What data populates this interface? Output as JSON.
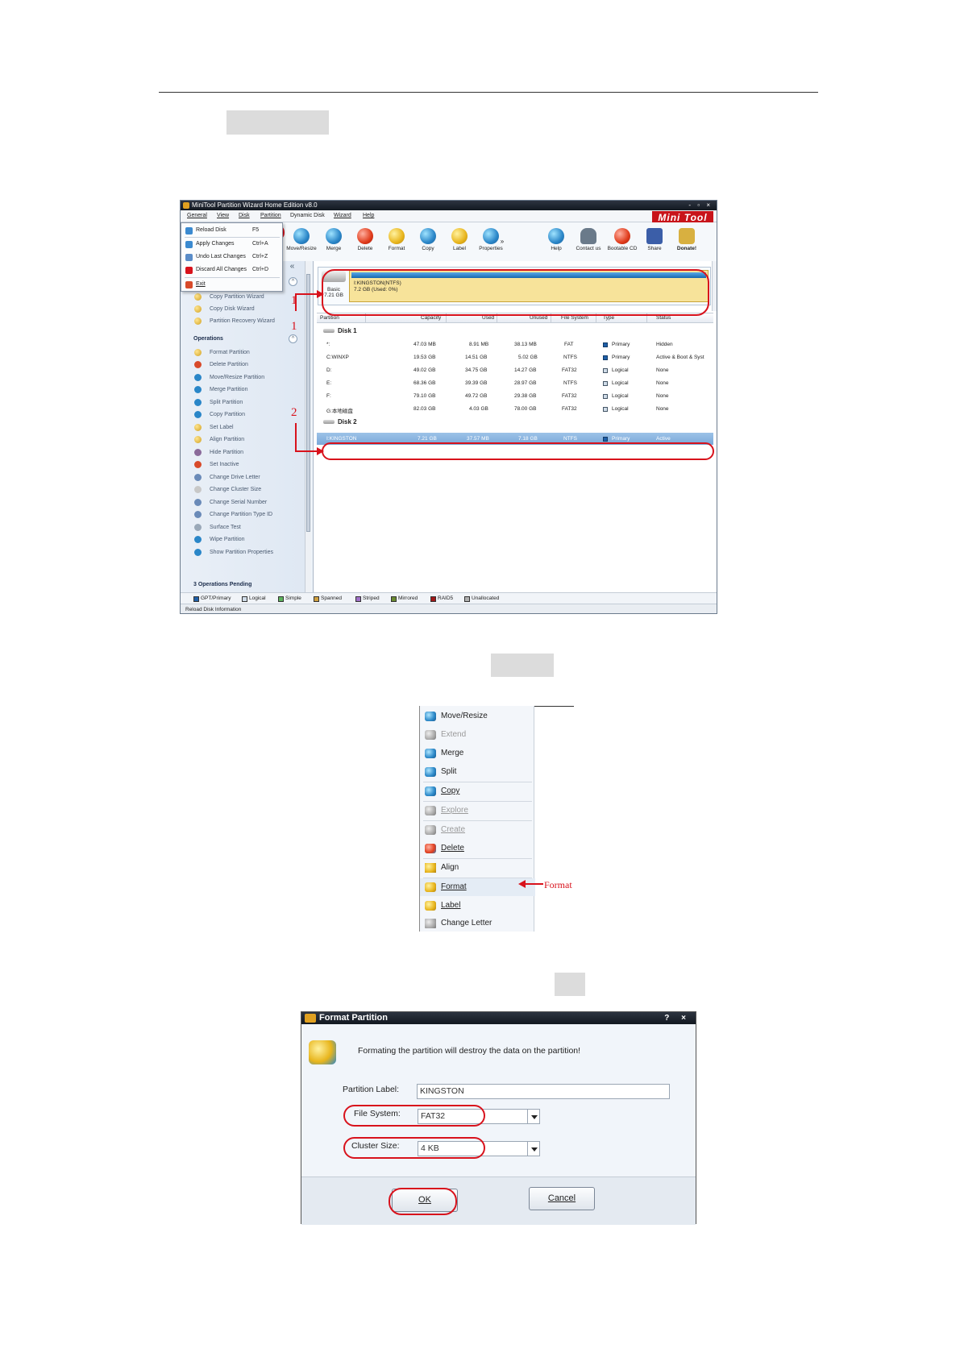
{
  "window": {
    "title": "MiniTool Partition Wizard Home Edition v8.0",
    "controls": "- ▫ ×",
    "logo": "Mini Tool"
  },
  "menubar": [
    "General",
    "View",
    "Disk",
    "Partition",
    "Dynamic Disk",
    "Wizard",
    "Help"
  ],
  "general_menu": [
    {
      "label": "Reload Disk",
      "shortcut": "F5"
    },
    {
      "label": "Apply Changes",
      "shortcut": "Ctrl+A"
    },
    {
      "label": "Undo Last Changes",
      "shortcut": "Ctrl+Z"
    },
    {
      "label": "Discard All Changes",
      "shortcut": "Ctrl+D"
    },
    {
      "label": "Exit",
      "shortcut": ""
    }
  ],
  "toolbar": {
    "left": [
      "Move/Resize",
      "Merge",
      "Delete",
      "Format",
      "Copy",
      "Label",
      "Properties"
    ],
    "more": "»",
    "right": [
      "Help",
      "Contact us",
      "Bootable CD",
      "Share",
      "Donate!"
    ]
  },
  "sidebar": {
    "collapse": "«",
    "wizards": [
      "Copy Partition Wizard",
      "Copy Disk Wizard",
      "Partition Recovery Wizard"
    ],
    "operations_title": "Operations",
    "operations": [
      "Format Partition",
      "Delete Partition",
      "Move/Resize Partition",
      "Merge Partition",
      "Split Partition",
      "Copy Partition",
      "Set Label",
      "Align Partition",
      "Hide Partition",
      "Set Inactive",
      "Change Drive Letter",
      "Change Cluster Size",
      "Change Serial Number",
      "Change Partition Type ID",
      "Surface Test",
      "Wipe Partition",
      "Show Partition Properties"
    ],
    "pending": "3 Operations Pending"
  },
  "disk_map": {
    "type": "Basic",
    "size": "7.21 GB",
    "partition_name": "I:KINGSTON(NTFS)",
    "partition_info": "7.2 GB (Used: 0%)"
  },
  "table": {
    "headers": [
      "Partition",
      "Capacity",
      "Used",
      "Unused",
      "File System",
      "Type",
      "Status"
    ],
    "disk1": "Disk 1",
    "disk2": "Disk 2",
    "rows": [
      [
        "*:",
        "47.03 MB",
        "8.91 MB",
        "38.13 MB",
        "FAT",
        "Primary",
        "Hidden"
      ],
      [
        "C:WINXP",
        "19.53 GB",
        "14.51 GB",
        "5.02 GB",
        "NTFS",
        "Primary",
        "Active & Boot & Syst"
      ],
      [
        "D:",
        "49.02 GB",
        "34.75 GB",
        "14.27 GB",
        "FAT32",
        "Logical",
        "None"
      ],
      [
        "E:",
        "68.36 GB",
        "39.39 GB",
        "28.97 GB",
        "NTFS",
        "Logical",
        "None"
      ],
      [
        "F:",
        "79.10 GB",
        "49.72 GB",
        "29.38 GB",
        "FAT32",
        "Logical",
        "None"
      ],
      [
        "G:本地磁盘",
        "82.03 GB",
        "4.03 GB",
        "78.00 GB",
        "FAT32",
        "Logical",
        "None"
      ]
    ],
    "selected_row": [
      "I:KINGSTON",
      "7.21 GB",
      "37.57 MB",
      "7.18 GB",
      "NTFS",
      "Primary",
      "Active"
    ]
  },
  "legend": [
    "GPT/Primary",
    "Logical",
    "Simple",
    "Spanned",
    "Striped",
    "Mirrored",
    "RAID5",
    "Unallocated"
  ],
  "legend_colors": [
    "#1f5fa8",
    "#d0dce8",
    "#5db35d",
    "#d0a040",
    "#a070c8",
    "#6a8a30",
    "#a01818",
    "#b0b0b0"
  ],
  "statusbar": "Reload Disk  Information",
  "annotations": {
    "one": "1",
    "two": "2",
    "format_note": "Format"
  },
  "context_menu": [
    {
      "label": "Move/Resize",
      "disabled": false
    },
    {
      "label": "Extend",
      "disabled": true
    },
    {
      "label": "Merge",
      "disabled": false
    },
    {
      "label": "Split",
      "disabled": false
    },
    {
      "label": "Copy",
      "disabled": false
    },
    {
      "label": "Explore",
      "disabled": true
    },
    {
      "label": "Create",
      "disabled": true
    },
    {
      "label": "Delete",
      "disabled": false
    },
    {
      "label": "Align",
      "disabled": false
    },
    {
      "label": "Format",
      "disabled": false
    },
    {
      "label": "Label",
      "disabled": false
    },
    {
      "label": "Change Letter",
      "disabled": false
    }
  ],
  "dialog": {
    "title": "Format Partition",
    "controls": "? ×",
    "warning": "Formating the partition will destroy the data on the partition!",
    "label_label": "Partition Label:",
    "label_value": "KINGSTON",
    "fs_label": "File System:",
    "fs_value": "FAT32",
    "cluster_label": "Cluster Size:",
    "cluster_value": "4 KB",
    "ok": "OK",
    "cancel": "Cancel"
  }
}
